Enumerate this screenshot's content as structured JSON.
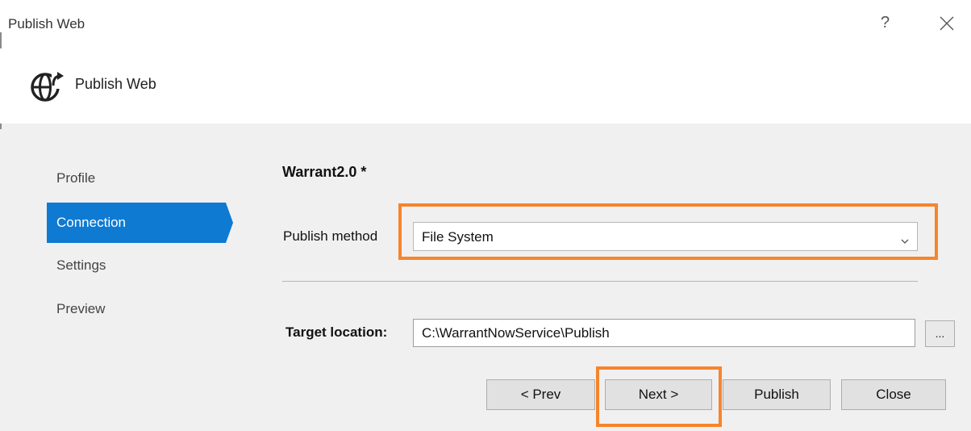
{
  "window": {
    "title": "Publish Web",
    "help_label": "?",
    "close_icon": "close-icon"
  },
  "header": {
    "title": "Publish Web",
    "icon": "globe-publish-icon"
  },
  "nav": {
    "items": [
      {
        "label": "Profile",
        "active": false
      },
      {
        "label": "Connection",
        "active": true
      },
      {
        "label": "Settings",
        "active": false
      },
      {
        "label": "Preview",
        "active": false
      }
    ]
  },
  "form": {
    "profile_name": "Warrant2.0 *",
    "publish_method_label": "Publish method",
    "publish_method_value": "File System",
    "target_location_label": "Target location:",
    "target_location_value": "C:\\WarrantNowService\\Publish",
    "browse_label": "..."
  },
  "buttons": {
    "prev": "< Prev",
    "next": "Next >",
    "publish": "Publish",
    "close": "Close"
  },
  "colors": {
    "accent": "#0e7ad2",
    "highlight": "#f5852d"
  }
}
